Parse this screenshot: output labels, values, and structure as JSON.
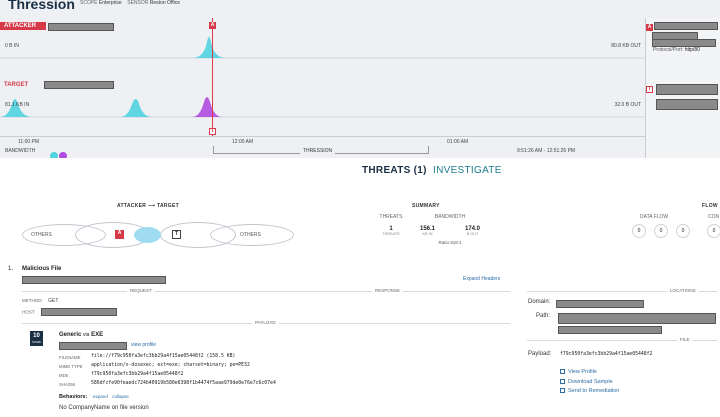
{
  "header": {
    "title": "Thression",
    "scope_label": "SCOPE",
    "scope_value": "Enterprise",
    "sensor_label": "SENSOR",
    "sensor_value": "Reston Office"
  },
  "timeline": {
    "attacker_label": "ATTACKER",
    "target_label": "TARGET",
    "attacker_in": "0 B IN",
    "attacker_out": "80.8 KB OUT",
    "target_in": "81.1 KB IN",
    "target_out": "32.0 B OUT",
    "cursor_top_tag": "A",
    "cursor_bottom_tag": "T",
    "ticks": [
      "11:00 PM",
      "12:00 AM",
      "01:00 AM",
      "9:51:26 AM - 12:51:26 PM"
    ],
    "range_label": "THRESSION",
    "bandwidth_label": "BANDWIDTH",
    "colors": {
      "inbound": "#4fd3e0",
      "outbound": "#b04be0",
      "cursor": "#e23c4a"
    }
  },
  "side_panel": {
    "tag_a": "A",
    "tag_t": "T",
    "proto_label": "Protocol/Port:",
    "proto_value": "http/80"
  },
  "tabs": {
    "threats": "THREATS (1)",
    "investigate": "INVESTIGATE"
  },
  "attacker_target": {
    "heading": "ATTACKER ⟶ TARGET",
    "left_others": "OTHERS",
    "right_others": "OTHERS",
    "attacker_tag": "A",
    "target_tag": "T"
  },
  "summary": {
    "heading": "SUMMARY",
    "threats_label": "THREATS",
    "bandwidth_label": "BANDWIDTH",
    "threats_value": "1",
    "threats_sub": "THREATS",
    "bw_in": "156.1",
    "bw_in_sub": "KB IN",
    "bw_out": "174.0",
    "bw_out_sub": "B OUT",
    "ratio": "Ratio 918:1"
  },
  "flow": {
    "heading": "FLOW",
    "data_flow_label": "DATA FLOW",
    "con_label": "CON",
    "c1": "0",
    "c2": "0",
    "c3": "0",
    "c4": "0",
    "u1": "CPS",
    "u2": "B",
    "u3": "PS"
  },
  "threat": {
    "index": "1.",
    "title": "Malicious File",
    "expand_headers": "Expand Headers",
    "request_label": "REQUEST",
    "response_label": "RESPONSE",
    "locations_label": "LOCATIONS",
    "method_label": "METHOD:",
    "method_value": "GET",
    "host_label": "HOST:",
    "payload_label": "PAYLOAD",
    "domain_label": "Domain:",
    "path_label": "Path:",
    "file_label": "FILE",
    "score": "10",
    "score_sub": "SCORE",
    "name": "Generic",
    "via": "via",
    "engine": "EXE",
    "view_profile_inline": "view profile",
    "rows": [
      {
        "k": "FILENAME",
        "v": "file://f79c950fa3efc3bb29a4f15ae05448f2 (158.5 KB)"
      },
      {
        "k": "MIME TYPE",
        "v": "application/x-dosexec; ext=exe; charset=binary; pe=PE32"
      },
      {
        "k": "MD5",
        "v": "f79c950fa3efc3bb29a4f15ae05448f2"
      },
      {
        "k": "SHA256",
        "v": "586dfcfe90feaedc724b40919b580e6398f1b4474f5aae979de0e76e7c6c07e4"
      }
    ],
    "payload_key": "Payload:",
    "payload_value": "f79c950fa3efc3bb29a4f15ae05448f2",
    "behaviors_label": "Behaviors:",
    "expand": "expand",
    "collapse": "collapse",
    "behavior_1": "No CompanyName on file version",
    "actions": [
      "View Profile",
      "Download Sample",
      "Send to Remediation"
    ]
  }
}
